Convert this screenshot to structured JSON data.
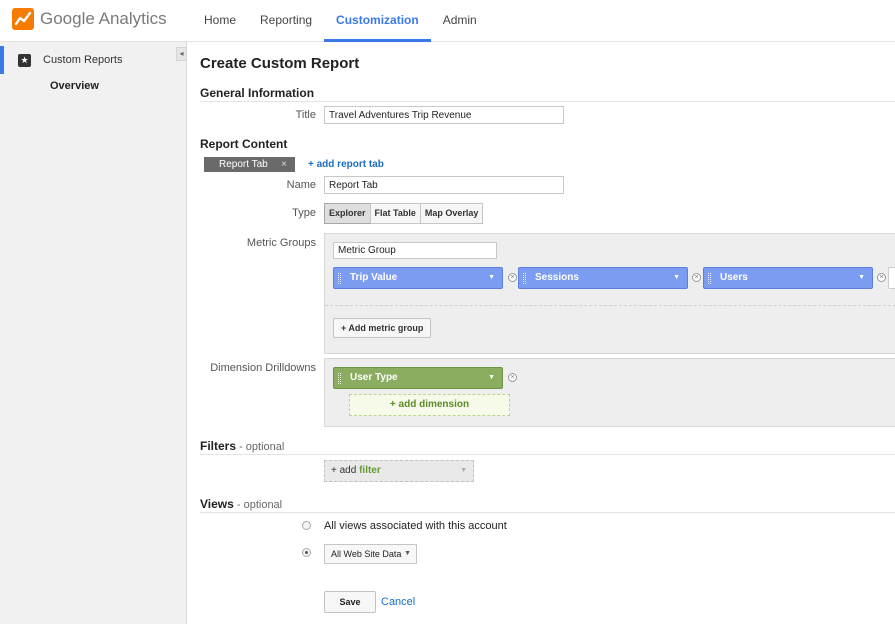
{
  "app": {
    "logo_text": "Google Analytics",
    "brand_color": "#f57c00",
    "accent_color": "#3b78e7",
    "nav": [
      {
        "label": "Home"
      },
      {
        "label": "Reporting"
      },
      {
        "label": "Customization",
        "active": true
      },
      {
        "label": "Admin"
      }
    ]
  },
  "sidebar": {
    "header_label": "Custom Reports",
    "header_icon": "star-icon",
    "collapse_icon": "◂",
    "sub_item": "Overview"
  },
  "page": {
    "title": "Create Custom Report",
    "general": {
      "heading": "General Information",
      "title_label": "Title",
      "title_value": "Travel Adventures Trip Revenue"
    },
    "content": {
      "heading": "Report Content",
      "tab_label": "Report Tab",
      "tab_close": "×",
      "add_tab": "+ add report tab",
      "name_label": "Name",
      "name_value": "Report Tab",
      "type_label": "Type",
      "types": [
        "Explorer",
        "Flat Table",
        "Map Overlay"
      ],
      "selected_type": "Explorer",
      "metric_groups_label": "Metric Groups",
      "metric_group_name": "Metric Group",
      "metric_color": "#7c9cf2",
      "metrics": [
        "Trip Value",
        "Sessions",
        "Users"
      ],
      "add_metric_group": "+ Add metric group",
      "dimension_label": "Dimension Drilldowns",
      "dimension_color": "#8aad5f",
      "dimension": "User Type",
      "add_dimension": "+ add dimension"
    },
    "filters": {
      "heading": "Filters",
      "optional": " - optional",
      "add_prefix": "+ add ",
      "add_word": "filter"
    },
    "views": {
      "heading": "Views",
      "optional": " - optional",
      "all_views_label": "All views associated with this account",
      "selected_view": "All Web Site Data"
    },
    "actions": {
      "save": "Save",
      "cancel": "Cancel"
    }
  }
}
